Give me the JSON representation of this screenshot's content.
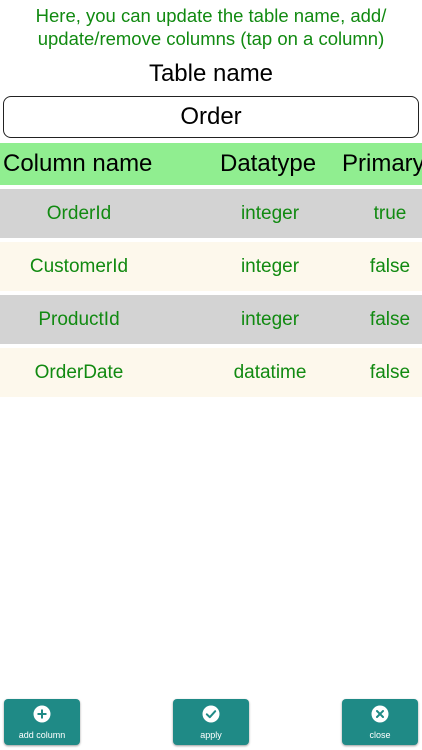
{
  "instructions": {
    "line1": "Here, you can update the table name, add/",
    "line2": "update/remove columns (tap on a column)"
  },
  "table_name_label": "Table name",
  "table_name_value": "Order",
  "columns_header": {
    "name": "Column name",
    "datatype": "Datatype",
    "primary": "Primary"
  },
  "rows": [
    {
      "name": "OrderId",
      "datatype": "integer",
      "primary": "true"
    },
    {
      "name": "CustomerId",
      "datatype": "integer",
      "primary": "false"
    },
    {
      "name": "ProductId",
      "datatype": "integer",
      "primary": "false"
    },
    {
      "name": "OrderDate",
      "datatype": "datatime",
      "primary": "false"
    }
  ],
  "buttons": {
    "add": {
      "label": "add column",
      "icon": "plus-circle-icon"
    },
    "apply": {
      "label": "apply",
      "icon": "check-circle-icon"
    },
    "close": {
      "label": "close",
      "icon": "x-circle-icon"
    }
  },
  "colors": {
    "instruction_text": "#118a11",
    "header_bg": "#90ee90",
    "row_alt_gray": "#d3d3d3",
    "row_alt_cream": "#fdf8ec",
    "button_bg": "#1f8a86"
  }
}
